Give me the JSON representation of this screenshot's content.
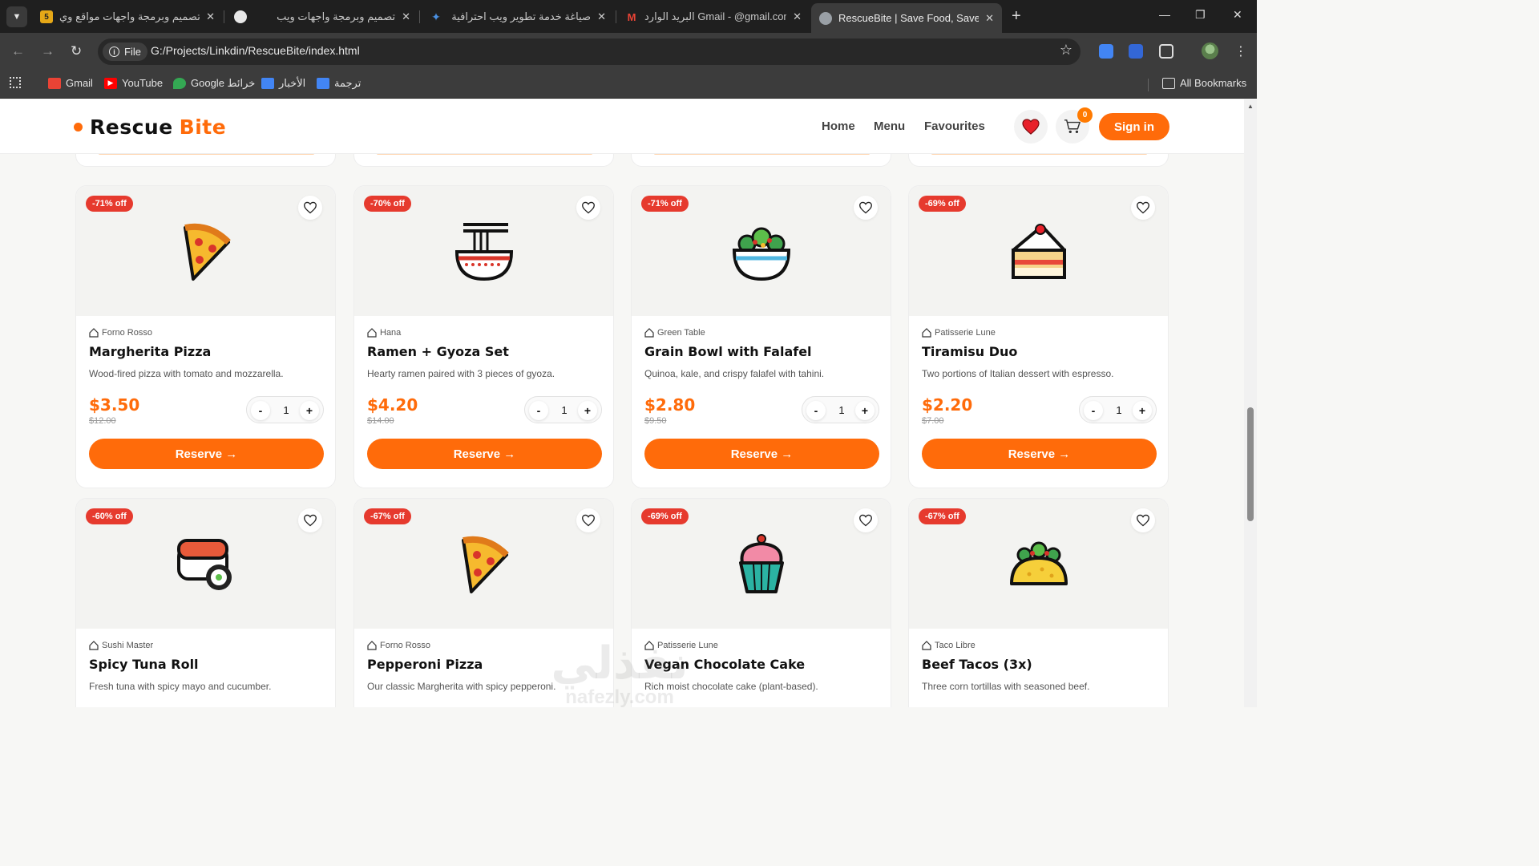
{
  "browser": {
    "tabs": [
      {
        "title": "تصميم وبرمجة واجهات مواقع وي",
        "favicon_color": "#e6a817",
        "favicon_text": "5",
        "active": false
      },
      {
        "title": "تصميم وبرمجة واجهات ويب",
        "favicon_color": "#e8e8e8",
        "favicon_text": "",
        "active": false
      },
      {
        "title": "صياغة خدمة تطوير ويب احترافية",
        "favicon_color": "#4a90e2",
        "favicon_text": "",
        "active": false
      },
      {
        "title": "البريد الوارد Gmail - @gmail.com",
        "favicon_color": "#ea4335",
        "favicon_text": "M",
        "active": false
      },
      {
        "title": "RescueBite | Save Food, Save M",
        "favicon_color": "#9aa0a6",
        "favicon_text": "",
        "active": true
      }
    ],
    "omnibox": {
      "scheme_label": "File",
      "url": "G:/Projects/Linkdin/RescueBite/index.html"
    },
    "bookmarks": [
      {
        "label": "Gmail",
        "color": "#ea4335",
        "icon": "gmail-icon"
      },
      {
        "label": "YouTube",
        "color": "#ff0000",
        "icon": "youtube-icon"
      },
      {
        "label": "Google خرائط",
        "color": "#34a853",
        "icon": "maps-icon"
      },
      {
        "label": "الأخبار",
        "color": "#4285f4",
        "icon": "news-icon"
      },
      {
        "label": "ترجمة",
        "color": "#4285f4",
        "icon": "translate-icon"
      }
    ],
    "all_bookmarks_label": "All Bookmarks"
  },
  "site": {
    "logo_part1": "Rescue",
    "logo_part2": "Bite",
    "accent": "#ff6b0a",
    "nav": [
      "Home",
      "Menu",
      "Favourites"
    ],
    "cart_count": "0",
    "signin_label": "Sign in"
  },
  "cards": [
    {
      "discount": "-71% off",
      "store": "Forno Rosso",
      "name": "Margherita Pizza",
      "desc": "Wood-fired pizza with tomato and mozzarella.",
      "price": "$3.50",
      "old_price": "$12.00",
      "qty": "1",
      "reserve": "Reserve →",
      "icon": "pizza-icon"
    },
    {
      "discount": "-70% off",
      "store": "Hana",
      "name": "Ramen + Gyoza Set",
      "desc": "Hearty ramen paired with 3 pieces of gyoza.",
      "price": "$4.20",
      "old_price": "$14.00",
      "qty": "1",
      "reserve": "Reserve →",
      "icon": "ramen-icon"
    },
    {
      "discount": "-71% off",
      "store": "Green Table",
      "name": "Grain Bowl with Falafel",
      "desc": "Quinoa, kale, and crispy falafel with tahini.",
      "price": "$2.80",
      "old_price": "$9.50",
      "qty": "1",
      "reserve": "Reserve →",
      "icon": "salad-bowl-icon"
    },
    {
      "discount": "-69% off",
      "store": "Patisserie Lune",
      "name": "Tiramisu Duo",
      "desc": "Two portions of Italian dessert with espresso.",
      "price": "$2.20",
      "old_price": "$7.00",
      "qty": "1",
      "reserve": "Reserve →",
      "icon": "cake-slice-icon"
    },
    {
      "discount": "-60% off",
      "store": "Sushi Master",
      "name": "Spicy Tuna Roll",
      "desc": "Fresh tuna with spicy mayo and cucumber.",
      "icon": "sushi-icon"
    },
    {
      "discount": "-67% off",
      "store": "Forno Rosso",
      "name": "Pepperoni Pizza",
      "desc": "Our classic Margherita with spicy pepperoni.",
      "icon": "pizza-icon"
    },
    {
      "discount": "-69% off",
      "store": "Patisserie Lune",
      "name": "Vegan Chocolate Cake",
      "desc": "Rich moist chocolate cake (plant-based).",
      "icon": "cupcake-icon"
    },
    {
      "discount": "-67% off",
      "store": "Taco Libre",
      "name": "Beef Tacos (3x)",
      "desc": "Three corn tortillas with seasoned beef.",
      "icon": "taco-icon"
    }
  ],
  "watermark": {
    "line1": "نفذلي",
    "line2": "nafezly.com"
  }
}
